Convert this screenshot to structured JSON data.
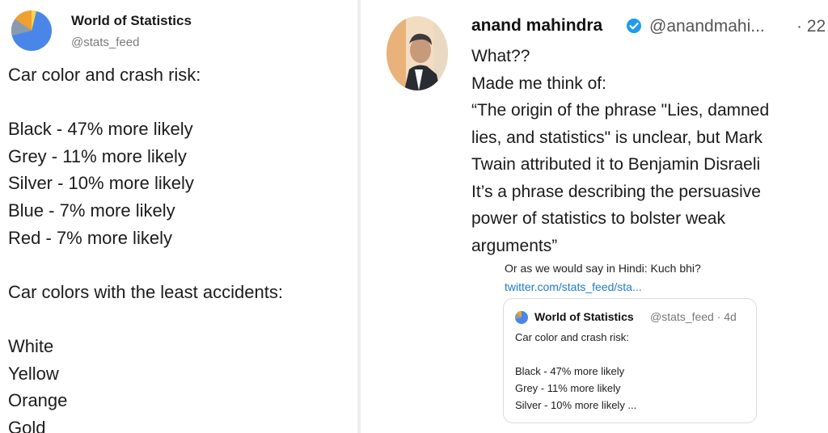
{
  "left_tweet": {
    "author_name": "World of Statistics",
    "handle": "@stats_feed",
    "avatar_icon": "pie-chart-icon",
    "lines": [
      "Car color and crash risk:",
      "",
      "Black - 47% more likely",
      "Grey - 11% more likely",
      "Silver - 10% more likely",
      "Blue - 7% more likely",
      "Red - 7% more likely",
      "",
      "Car colors with the least accidents:",
      "",
      "White",
      "Yellow",
      "Orange",
      "Gold"
    ]
  },
  "right_tweet": {
    "author_name": "anand mahindra",
    "verified_icon": "verified-badge-icon",
    "handle": "@anandmahi...",
    "time": "· 22",
    "lines": [
      "What??",
      "Made me think of:",
      "“The origin of the phrase \"Lies, damned",
      "lies, and statistics\" is unclear, but Mark",
      "Twain attributed it to Benjamin Disraeli",
      "It’s a phrase describing the persuasive",
      "power of statistics to bolster weak",
      "arguments”"
    ],
    "reply_text": "Or as we would say in Hindi: Kuch bhi?",
    "reply_link": "twitter.com/stats_feed/sta..."
  },
  "quoted_tweet": {
    "author_name": "World of Statistics",
    "meta": "@stats_feed · 4d",
    "lines": [
      "Car color and crash risk:",
      "",
      "Black - 47% more likely",
      "Grey - 11% more likely",
      "Silver - 10% more likely  ..."
    ]
  },
  "colors": {
    "pie_blue": "#4a86e8",
    "pie_orange": "#f0a030",
    "pie_gray": "#8a9bb0",
    "pie_yellow": "#f6d54a",
    "verified_blue": "#1d9bf0",
    "link_blue": "#1d7cc9"
  }
}
